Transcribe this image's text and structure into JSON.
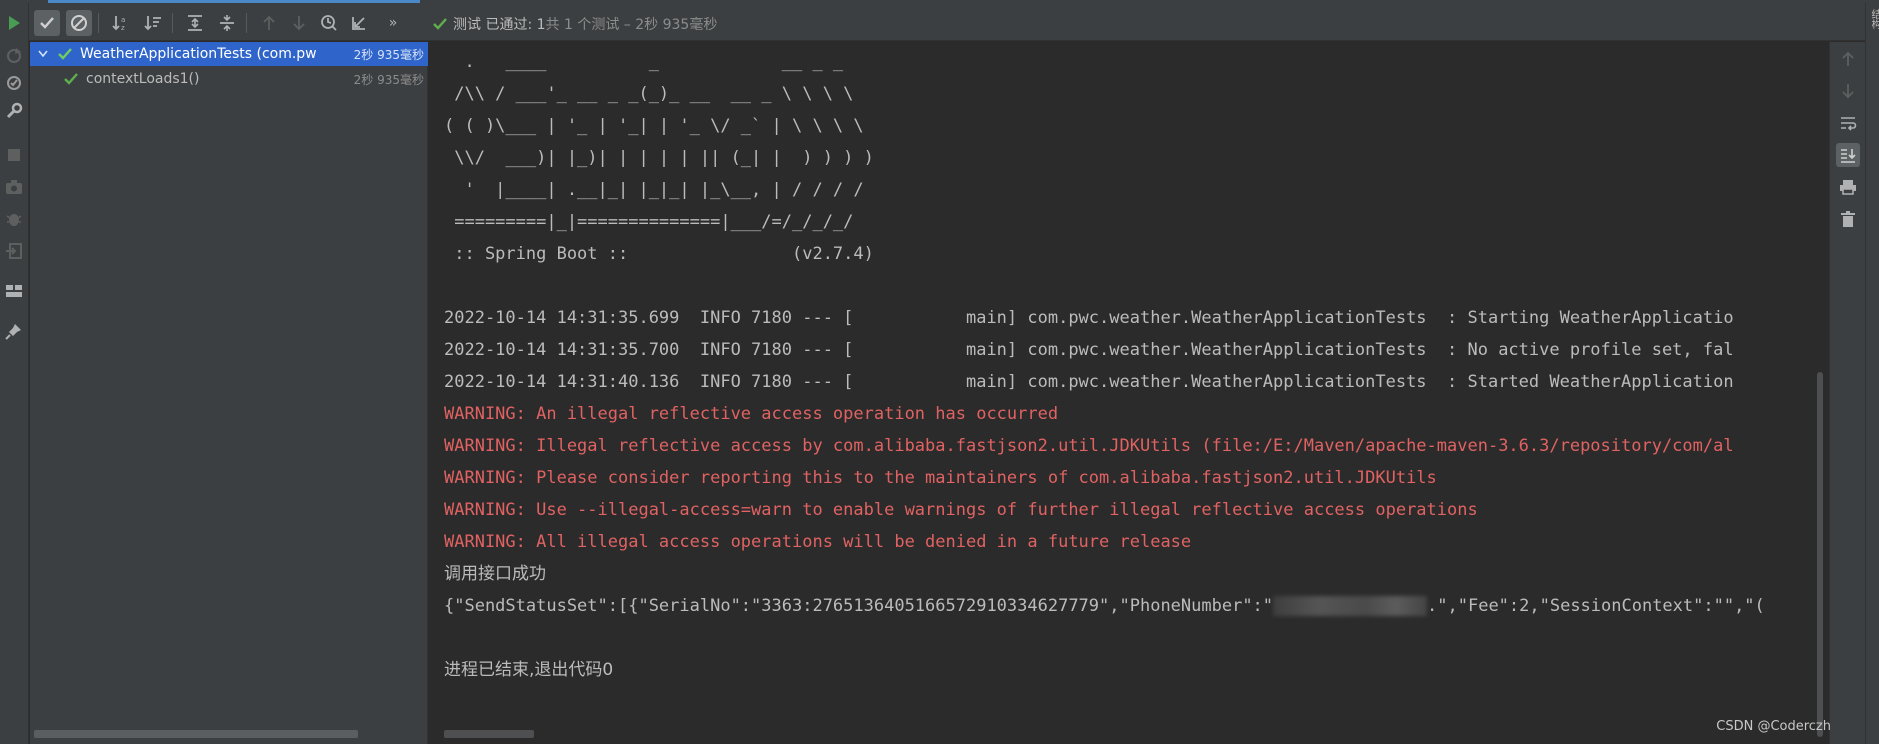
{
  "toolbar": {
    "buttons": [
      "show-passed",
      "show-ignored",
      "sort-alpha",
      "sort-duration",
      "expand-all",
      "collapse-all",
      "prev-failed",
      "next-failed",
      "test-history",
      "import-tests",
      "more"
    ],
    "more_label": "»"
  },
  "status": {
    "main": "测试 已通过: 1",
    "rest": "共 1 个测试 – 2秒 935毫秒"
  },
  "tree": {
    "root": {
      "label": "WeatherApplicationTests (com.pw",
      "time": "2秒 935毫秒"
    },
    "child": {
      "label": "contextLoads1()",
      "time": "2秒 935毫秒"
    }
  },
  "console": {
    "banner": [
      "  .   ____          _            __ _ _",
      " /\\\\ / ___'_ __ _ _(_)_ __  __ _ \\ \\ \\ \\",
      "( ( )\\___ | '_ | '_| | '_ \\/ _` | \\ \\ \\ \\",
      " \\\\/  ___)| |_)| | | | | || (_| |  ) ) ) )",
      "  '  |____| .__|_| |_|_| |_\\__, | / / / /",
      " =========|_|==============|___/=/_/_/_/",
      " :: Spring Boot ::                (v2.7.4)"
    ],
    "log": [
      "2022-10-14 14:31:35.699  INFO 7180 --- [           main] com.pwc.weather.WeatherApplicationTests  : Starting WeatherApplicatio",
      "2022-10-14 14:31:35.700  INFO 7180 --- [           main] com.pwc.weather.WeatherApplicationTests  : No active profile set, fal",
      "2022-10-14 14:31:40.136  INFO 7180 --- [           main] com.pwc.weather.WeatherApplicationTests  : Started WeatherApplication"
    ],
    "warnings": [
      "WARNING: An illegal reflective access operation has occurred",
      "WARNING: Illegal reflective access by com.alibaba.fastjson2.util.JDKUtils (file:/E:/Maven/apache-maven-3.6.3/repository/com/al",
      "WARNING: Please consider reporting this to the maintainers of com.alibaba.fastjson2.util.JDKUtils",
      "WARNING: Use --illegal-access=warn to enable warnings of further illegal reflective access operations",
      "WARNING: All illegal access operations will be denied in a future release"
    ],
    "success": "调用接口成功",
    "json_start": "{\"SendStatusSet\":[{\"SerialNo\":\"3363:2765136405166572910334627779\",\"PhoneNumber\":\"",
    "json_end": ".\",\"Fee\":2,\"SessionContext\":\"\",\"(",
    "exit": "进程已结束,退出代码0"
  },
  "edge_label": "结构",
  "watermark": "CSDN @Coderczh",
  "colors": {
    "background": "#2b2b2b",
    "panel": "#3c3f41",
    "selected": "#2f65ca",
    "pass_green": "#5faf4e",
    "warning_red": "#e06262",
    "run_green": "#499c54"
  }
}
